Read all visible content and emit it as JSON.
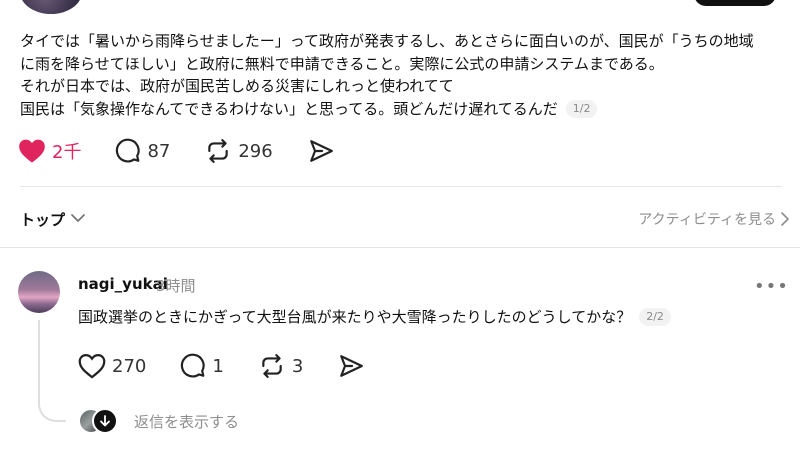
{
  "post": {
    "lines": [
      "タイでは「暑いから雨降らせましたー」って政府が発表するし、あとさらに面白いのが、国民が「うちの地域",
      "に雨を降らせてほしい」と政府に無料で申請できること。実際に公式の申請システムまである。",
      "それが日本では、政府が国民苦しめる災害にしれっと使われてて",
      "国民は「気象操作なんてできるわけない」と思ってる。頭どんだけ遅れてるんだ"
    ],
    "pager": "1/2",
    "likes": "2千",
    "comments": "87",
    "reposts": "296"
  },
  "sort": {
    "label": "トップ",
    "activity_label": "アクティビティを見る"
  },
  "reply": {
    "username": "nagi_yukai",
    "time": "3時間",
    "more": "•••",
    "text": "国政選挙のときにかぎって大型台風が来たりや大雪降ったりしたのどうしてかな？",
    "pager": "2/2",
    "likes": "270",
    "comments": "1",
    "reposts": "3",
    "show_replies_label": "返信を表示する"
  },
  "colors": {
    "like_active": "#e0245e",
    "muted_text": "#8e8e8e",
    "divider": "#e6e6e6"
  },
  "icons": [
    "heart-icon",
    "comment-icon",
    "repost-icon",
    "share-icon",
    "chevron-down-icon",
    "chevron-right-icon",
    "more-icon",
    "arrow-down-icon"
  ]
}
